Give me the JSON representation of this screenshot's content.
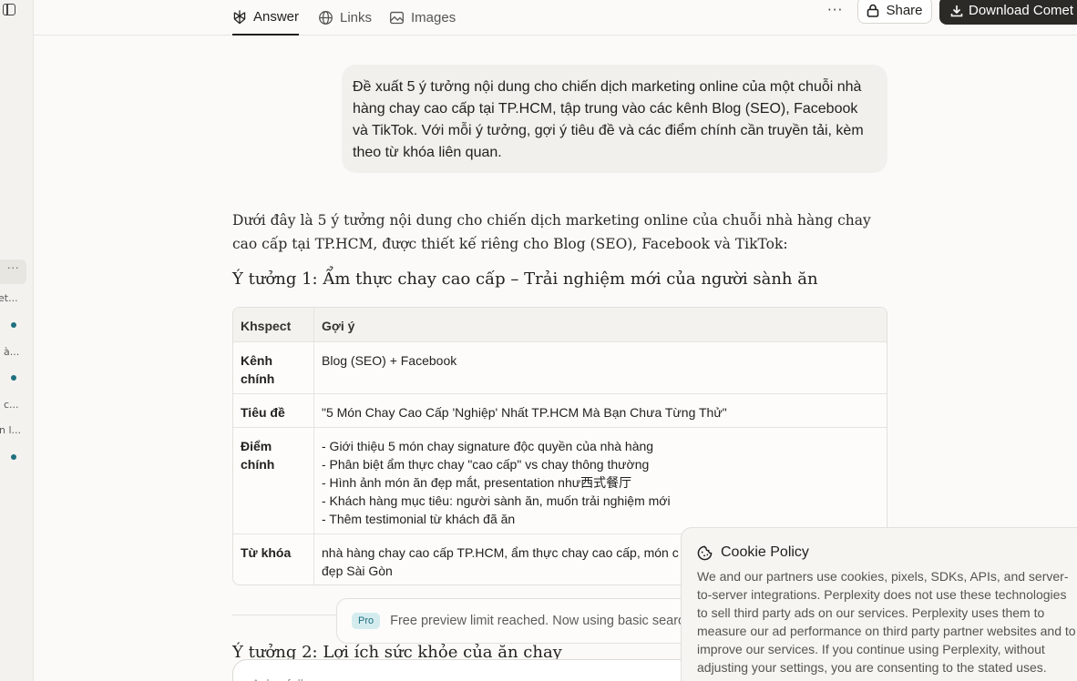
{
  "tabs": [
    {
      "label": "Answer",
      "icon": "perplexity-icon",
      "active": true
    },
    {
      "label": "Links",
      "icon": "globe-icon",
      "active": false
    },
    {
      "label": "Images",
      "icon": "image-icon",
      "active": false
    }
  ],
  "header": {
    "more": "···",
    "share_label": "Share",
    "download_label": "Download Comet"
  },
  "sidebar": {
    "dots": "···",
    "items": [
      "et...",
      "à...",
      "c...",
      "n l..."
    ]
  },
  "query": "Đề xuất 5 ý tưởng nội dung cho chiến dịch marketing online của một chuỗi nhà hàng chay cao cấp tại TP.HCM, tập trung vào các kênh Blog (SEO), Facebook và TikTok. Với mỗi ý tưởng, gợi ý tiêu đề và các điểm chính cần truyền tải, kèm theo từ khóa liên quan.",
  "answer": {
    "intro": "Dưới đây là 5 ý tưởng nội dung cho chiến dịch marketing online của chuỗi nhà hàng chay cao cấp tại TP.HCM, được thiết kế riêng cho Blog (SEO), Facebook và TikTok:",
    "idea1_title": "Ý tưởng 1: Ẩm thực chay cao cấp – Trải nghiệm mới của người sành ăn",
    "table": {
      "headers": [
        "Khspect",
        "Gợi ý"
      ],
      "rows": [
        {
          "label": "Kênh chính",
          "lines": [
            "Blog (SEO) + Facebook"
          ]
        },
        {
          "label": "Tiêu đề",
          "lines": [
            "\"5 Món Chay Cao Cấp 'Nghiệp' Nhất TP.HCM Mà Bạn Chưa Từng Thử\""
          ]
        },
        {
          "label": "Điểm chính",
          "lines": [
            "- Giới thiệu 5 món chay signature độc quyền của nhà hàng",
            "- Phân biệt ẩm thực chay \"cao cấp\" vs chay thông thường",
            "- Hình ảnh món ăn đẹp mắt, presentation như西式餐厅",
            "- Khách hàng mục tiêu: người sành ăn, muốn trải nghiệm mới",
            "- Thêm testimonial từ khách đã ăn"
          ]
        },
        {
          "label": "Từ khóa",
          "lines": [
            "nhà hàng chay cao cấp TP.HCM, ẩm thực chay cao cấp, món c",
            "đẹp Sài Gòn"
          ]
        }
      ]
    },
    "idea2_title": "Ý tưởng 2: Lợi ích sức khỏe của ăn chay"
  },
  "pro_notice": {
    "badge": "Pro",
    "text": "Free preview limit reached. Now using basic search"
  },
  "ask": {
    "placeholder": "Ask a follow-up"
  },
  "cookie": {
    "title": "Cookie Policy",
    "text": "We and our partners use cookies, pixels, SDKs, APIs, and server-to-server integrations. Perplexity does not use these technologies to sell third party ads on our services. Perplexity uses them to measure our ad performance on third party partner websites and to improve our services. If you continue using Perplexity, without adjusting your settings, you are consenting to the stated uses."
  },
  "colors": {
    "accent": "#1e6f7f",
    "dark_button": "#2b2a27",
    "background": "#fbfaf8"
  }
}
